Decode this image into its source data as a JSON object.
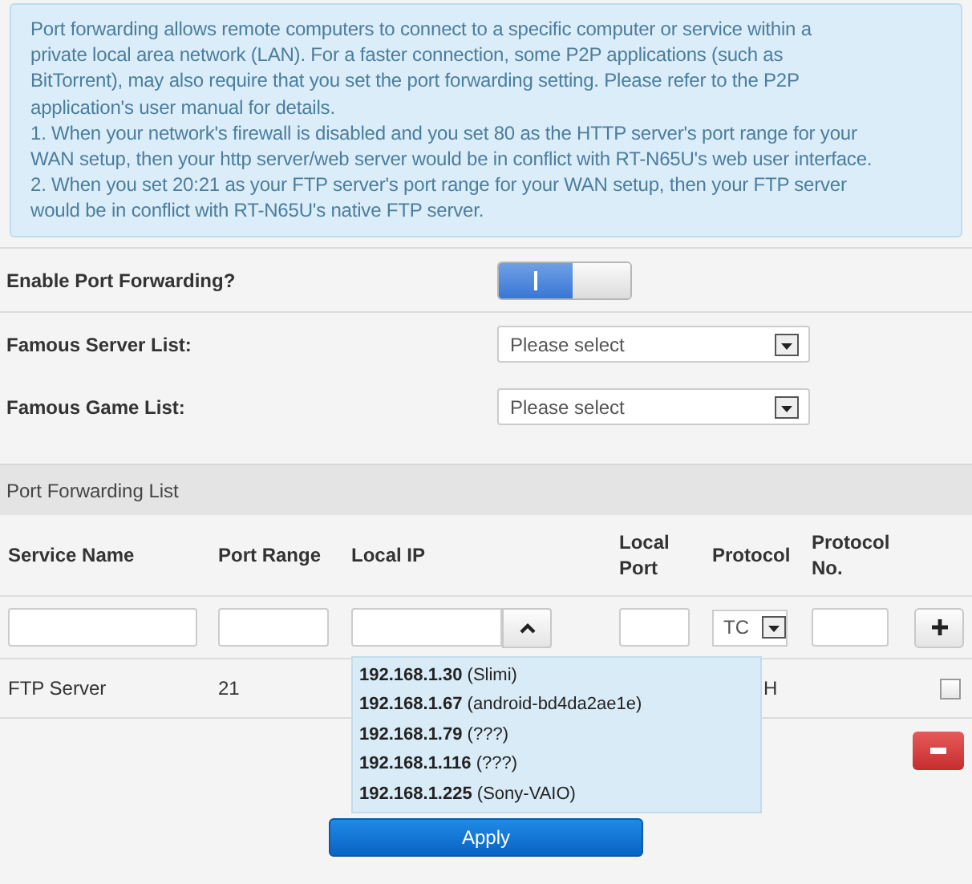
{
  "info": {
    "paragraphs": [
      "Port forwarding allows remote computers to connect to a specific computer or service within a private local area network (LAN). For a faster connection, some P2P applications (such as BitTorrent), may also require that you set the port forwarding setting. Please refer to the P2P application's user manual for details.",
      "1. When your network's firewall is disabled and you set 80 as the HTTP server's port range for your WAN setup, then your http server/web server would be in conflict with RT-N65U's web user interface.",
      "2. When you set 20:21 as your FTP server's port range for your WAN setup, then your FTP server would be in conflict with RT-N65U's native FTP server."
    ]
  },
  "settings": [
    {
      "kind": "toggle",
      "label": "Enable Port Forwarding?",
      "on": true
    },
    {
      "kind": "select",
      "label": "Famous Server List:",
      "value": "Please select"
    },
    {
      "kind": "select",
      "label": "Famous Game List:",
      "value": "Please select"
    }
  ],
  "list": {
    "title": "Port Forwarding List",
    "columns": [
      "Service Name",
      "Port Range",
      "Local IP",
      "Local Port",
      "Protocol",
      "Protocol No."
    ],
    "protocol_value": "TC",
    "rows": [
      {
        "service_name": "FTP Server",
        "port_range": "21",
        "protocol": "H",
        "checked": false
      }
    ],
    "ip_suggestions": [
      {
        "ip": "192.168.1.30",
        "name": "(Slimi)"
      },
      {
        "ip": "192.168.1.67",
        "name": "(android-bd4da2ae1e)"
      },
      {
        "ip": "192.168.1.79",
        "name": "(???)"
      },
      {
        "ip": "192.168.1.116",
        "name": "(???)"
      },
      {
        "ip": "192.168.1.225",
        "name": "(Sony-VAIO)"
      }
    ]
  },
  "apply_button": "Apply"
}
